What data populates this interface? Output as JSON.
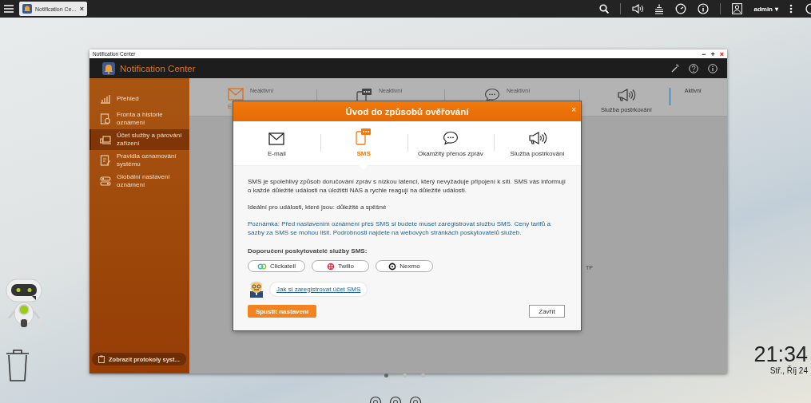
{
  "taskbar": {
    "tab_title": "Notification Ce...",
    "tab_close": "×",
    "user": "admin",
    "user_caret": "▾"
  },
  "window": {
    "title": "Notification Center",
    "app_name": "Notification Center",
    "controls": [
      {
        "kind": "minimize",
        "symbol": "−"
      },
      {
        "kind": "maximize",
        "symbol": "+"
      },
      {
        "kind": "close",
        "symbol": "×"
      }
    ]
  },
  "sidebar": {
    "items": [
      {
        "label": "Přehled",
        "kind": "chart",
        "selected": false
      },
      {
        "label": "Fronta a historie oznámení",
        "kind": "history",
        "selected": false
      },
      {
        "label": "Účet služby a párování zařízení",
        "kind": "devices",
        "selected": true
      },
      {
        "label": "Pravidla oznamování systému",
        "kind": "rules",
        "selected": false
      },
      {
        "label": "Globální nastavení oznámení",
        "kind": "settings",
        "selected": false
      }
    ],
    "log_button": "Zobrazit protokoly syst..."
  },
  "service_cards": [
    {
      "kind": "email",
      "label": "E",
      "status": "Neaktivní",
      "active": false
    },
    {
      "kind": "sms",
      "status": "Neaktivní",
      "active": false
    },
    {
      "kind": "chat",
      "status": "Neaktivní",
      "active": false
    },
    {
      "kind": "push",
      "label": "Služba postrkování",
      "status": "Aktivní",
      "active": true
    }
  ],
  "background_fragment": "TP",
  "dialog": {
    "title": "Úvod do způsobů ověřování",
    "close": "×",
    "tabs": [
      {
        "kind": "email",
        "label": "E-mail",
        "selected": false
      },
      {
        "kind": "sms",
        "label": "SMS",
        "selected": true
      },
      {
        "kind": "chat",
        "label": "Okamžitý přenos zpráv",
        "selected": false
      },
      {
        "kind": "push",
        "label": "Služba postrkování",
        "selected": false
      }
    ],
    "description": "SMS je spolehlivý způsob doručování zpráv s nízkou latencí, který nevyžaduje připojení k síti. SMS vás informují o každé důležité události na úložišti NAS a rychle reagují na důležité události.",
    "ideal": "Ideální pro události, které jsou: důležité a spěšné",
    "note": "Poznámka: Před nastavením oznámení přes SMS si budete muset zaregistrovat službu SMS. Ceny tarifů a sazby za SMS se mohou lišit. Podrobnosti najdete na webových stránkách poskytovatelů služeb.",
    "providers_heading": "Doporučení poskytovatelé služby SMS:",
    "providers": [
      {
        "kind": "clickatell",
        "name": "Clickatell"
      },
      {
        "kind": "twilio",
        "name": "Twilio"
      },
      {
        "kind": "nexmo",
        "name": "Nexmo"
      }
    ],
    "help_link": "Jak si zaregistrovat účet SMS",
    "primary_button": "Spustit nastavení",
    "close_button": "Zavřít"
  },
  "desktop": {
    "clock": "21:34",
    "date": "Stř., Říj 24",
    "pages": [
      {
        "selected": true
      },
      {
        "selected": false
      },
      {
        "selected": false
      }
    ]
  }
}
